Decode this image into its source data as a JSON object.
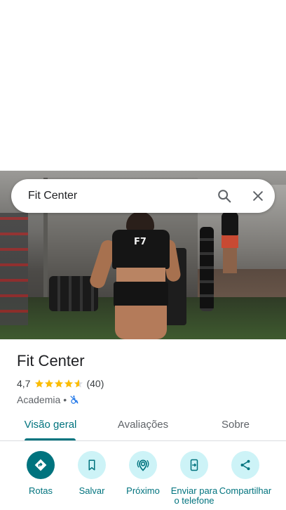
{
  "search": {
    "query": "Fit Center",
    "search_icon": "search-icon",
    "clear_icon": "close-icon"
  },
  "photo": {
    "description_icon": "place-photo",
    "shirt_logo": "F7"
  },
  "place": {
    "name": "Fit Center",
    "rating": "4,7",
    "rating_value": 4.7,
    "review_count": "(40)",
    "category": "Academia",
    "separator": "•",
    "accessibility_icon": "no-wheelchair-icon"
  },
  "tabs": [
    {
      "label": "Visão geral",
      "active": true
    },
    {
      "label": "Avaliações",
      "active": false
    },
    {
      "label": "Sobre",
      "active": false
    }
  ],
  "actions": [
    {
      "label": "Rotas",
      "icon": "directions-icon"
    },
    {
      "label": "Salvar",
      "icon": "bookmark-icon"
    },
    {
      "label": "Próximo",
      "icon": "nearby-icon"
    },
    {
      "label": "Enviar para o telefone",
      "icon": "send-to-phone-icon"
    },
    {
      "label": "Compartilhar",
      "icon": "share-icon"
    }
  ],
  "colors": {
    "accent": "#00737e",
    "accent_light": "#cdf3f7",
    "star": "#fbbc04",
    "accessibility": "#1a73e8"
  }
}
